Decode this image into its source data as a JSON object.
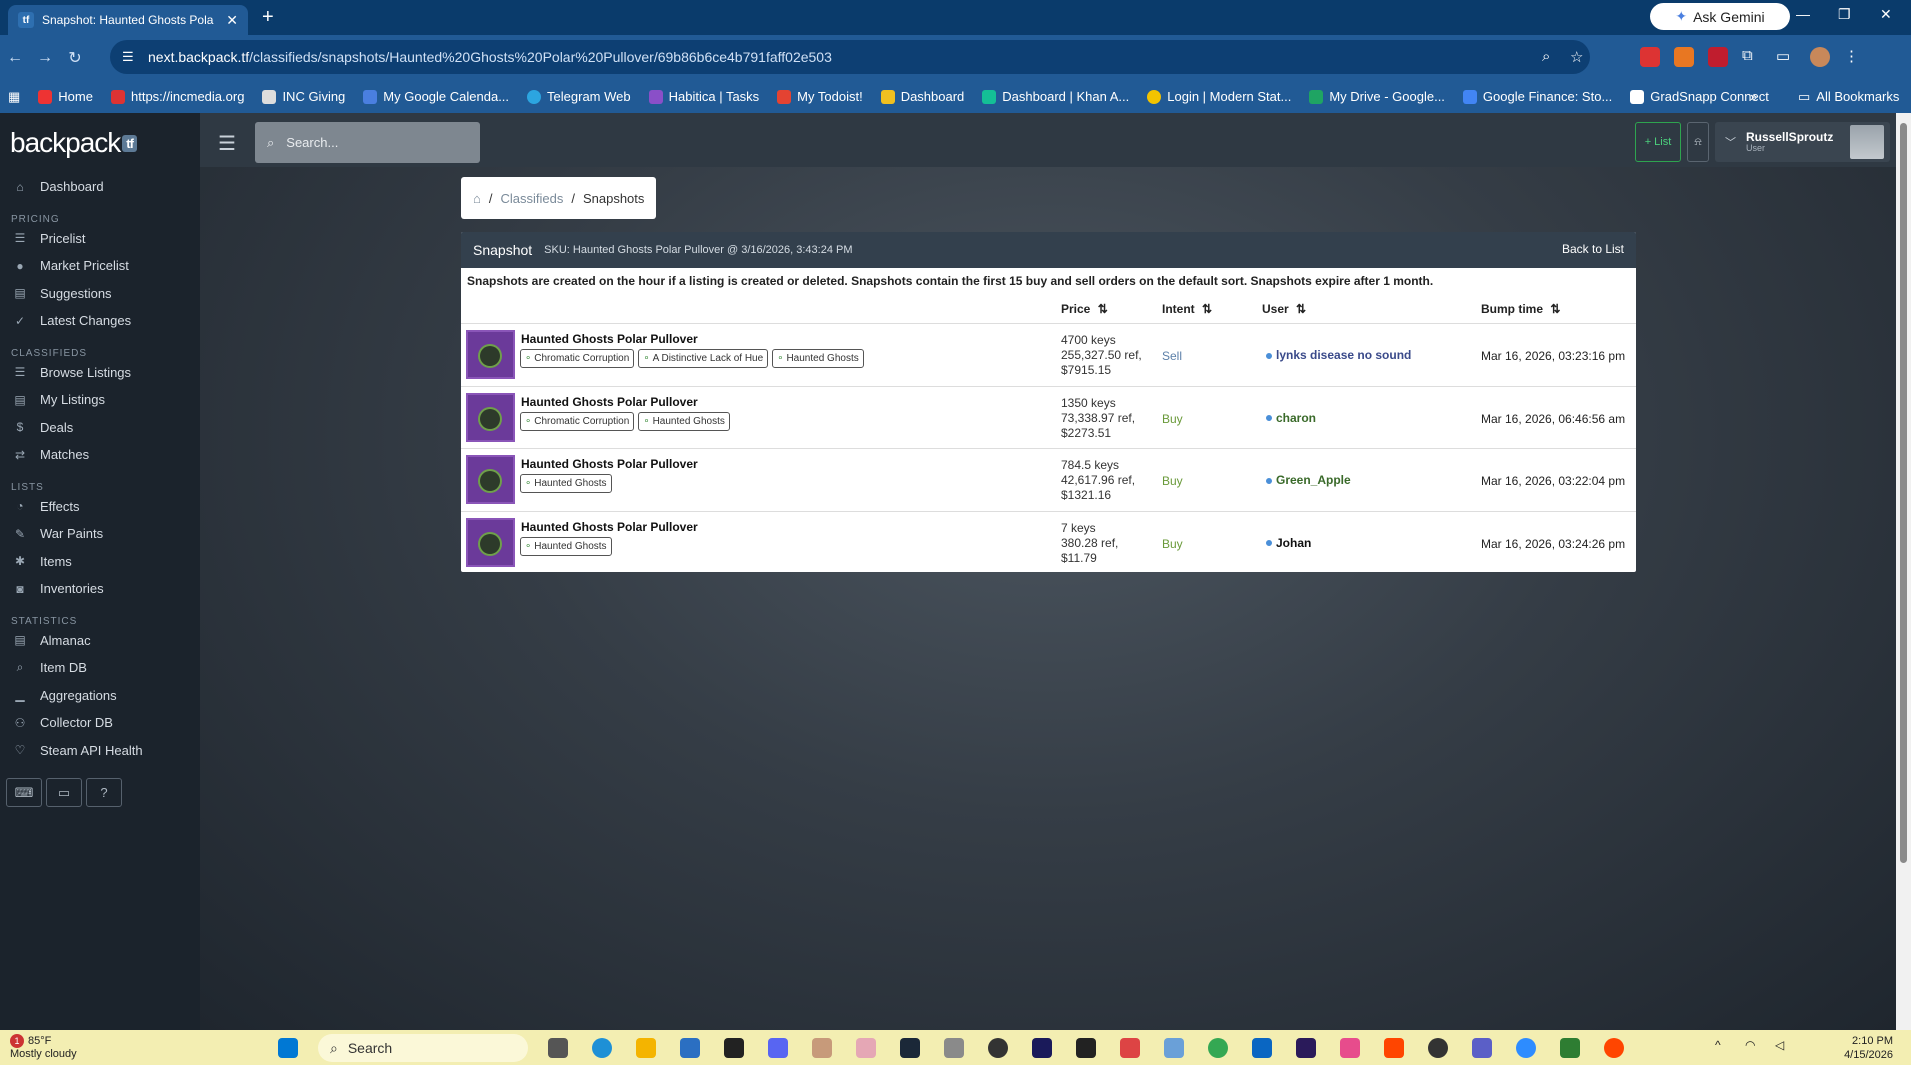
{
  "browser": {
    "tab_title": "Snapshot: Haunted Ghosts Pola",
    "ask_gemini": "Ask Gemini",
    "url_host": "next.backpack.tf",
    "url_path": "/classifieds/snapshots/Haunted%20Ghosts%20Polar%20Pullover/69b86b6ce4b791faff02e503",
    "bookmarks": [
      "Home",
      "https://incmedia.org",
      "INC Giving",
      "My Google Calenda...",
      "Telegram Web",
      "Habitica | Tasks",
      "My Todoist!",
      "Dashboard",
      "Dashboard | Khan A...",
      "Login | Modern Stat...",
      "My Drive - Google...",
      "Google Finance: Sto...",
      "GradSnapp Connect"
    ],
    "all_bookmarks": "All Bookmarks"
  },
  "sidebar": {
    "logo": "backpack",
    "logo_badge": "tf",
    "dashboard": "Dashboard",
    "sections": [
      {
        "title": "PRICING",
        "items": [
          "Pricelist",
          "Market Pricelist",
          "Suggestions",
          "Latest Changes"
        ]
      },
      {
        "title": "CLASSIFIEDS",
        "items": [
          "Browse Listings",
          "My Listings",
          "Deals",
          "Matches"
        ]
      },
      {
        "title": "LISTS",
        "items": [
          "Effects",
          "War Paints",
          "Items",
          "Inventories"
        ]
      },
      {
        "title": "STATISTICS",
        "items": [
          "Almanac",
          "Item DB",
          "Aggregations",
          "Collector DB",
          "Steam API Health"
        ]
      }
    ],
    "help_btn": "?"
  },
  "topbar": {
    "search_placeholder": "Search...",
    "list_btn": "+ List",
    "username": "RussellSproutz",
    "role": "User"
  },
  "breadcrumb": {
    "sep": "/",
    "classifieds": "Classifieds",
    "snapshots": "Snapshots"
  },
  "snapshot": {
    "title": "Snapshot",
    "sku": "SKU: Haunted Ghosts Polar Pullover @ 3/16/2026, 3:43:24 PM",
    "back": "Back to List",
    "note": "Snapshots are created on the hour if a listing is created or deleted. Snapshots contain the first 15 buy and sell orders on the default sort. Snapshots expire after 1 month.",
    "headers": {
      "price": "Price",
      "intent": "Intent",
      "user": "User",
      "bump": "Bump time"
    },
    "rows": [
      {
        "name": "Haunted Ghosts Polar Pullover",
        "tags": [
          "Chromatic Corruption",
          "A Distinctive Lack of Hue",
          "Haunted Ghosts"
        ],
        "p1": "4700 keys",
        "p2": "255,327.50 ref,",
        "p3": "$7915.15",
        "intent": "Sell",
        "user": "lynks disease no sound",
        "user_color": "#3a4a8a",
        "bump": "Mar 16, 2026, 03:23:16 pm"
      },
      {
        "name": "Haunted Ghosts Polar Pullover",
        "tags": [
          "Chromatic Corruption",
          "Haunted Ghosts"
        ],
        "p1": "1350 keys",
        "p2": "73,338.97 ref,",
        "p3": "$2273.51",
        "intent": "Buy",
        "user": "charon",
        "user_color": "#3a6a2a",
        "bump": "Mar 16, 2026, 06:46:56 am"
      },
      {
        "name": "Haunted Ghosts Polar Pullover",
        "tags": [
          "Haunted Ghosts"
        ],
        "p1": "784.5 keys",
        "p2": "42,617.96 ref,",
        "p3": "$1321.16",
        "intent": "Buy",
        "user": "Green_Apple",
        "user_color": "#3a6a2a",
        "bump": "Mar 16, 2026, 03:22:04 pm"
      },
      {
        "name": "Haunted Ghosts Polar Pullover",
        "tags": [
          "Haunted Ghosts"
        ],
        "p1": "7 keys",
        "p2": "380.28 ref,",
        "p3": "$11.79",
        "intent": "Buy",
        "user": "Johan",
        "user_color": "#111111",
        "bump": "Mar 16, 2026, 03:24:26 pm"
      }
    ]
  },
  "taskbar": {
    "temp": "85°F",
    "weather": "Mostly cloudy",
    "weather_badge": "1",
    "search": "Search",
    "time": "2:10 PM",
    "date": "4/15/2026"
  }
}
